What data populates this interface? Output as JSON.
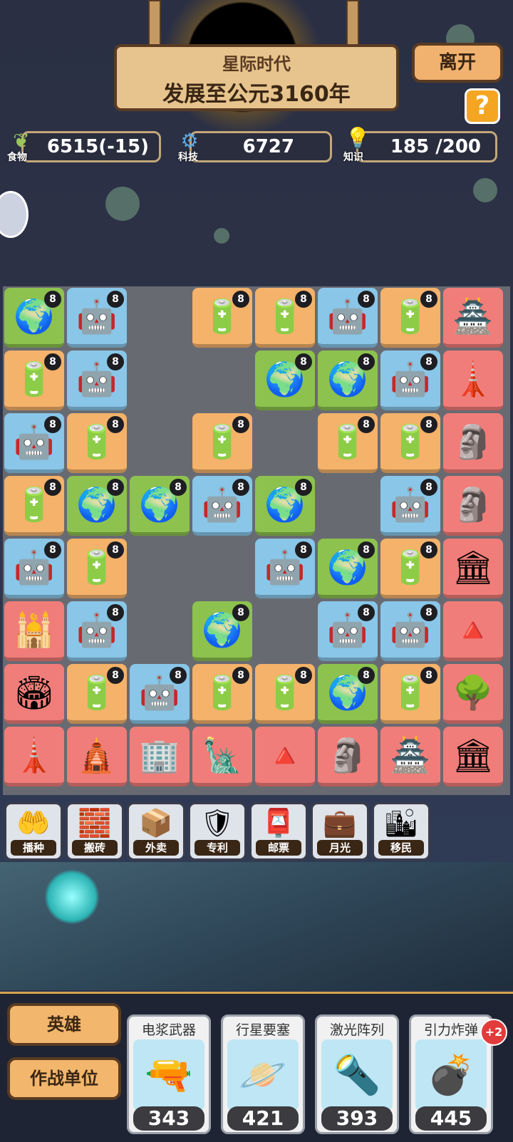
{
  "header": {
    "era": "星际时代",
    "year": "发展至公元3160年",
    "leave_label": "离开",
    "help_label": "?"
  },
  "resources": {
    "food": {
      "label": "食物",
      "value": "6515(-15)",
      "icon": "leaf-icon"
    },
    "tech": {
      "label": "科技",
      "value": "6727",
      "icon": "gear-icon"
    },
    "knowledge": {
      "label": "知识",
      "value": "185 /200",
      "icon": "lightbulb-icon"
    }
  },
  "board": {
    "badge": "8",
    "rows": [
      [
        "planet",
        "robot",
        "empty",
        "battery",
        "battery",
        "robot",
        "battery",
        "great-wall"
      ],
      [
        "battery",
        "robot",
        "empty",
        "empty",
        "planet",
        "planet",
        "robot",
        "eiffel-tower"
      ],
      [
        "robot",
        "battery",
        "empty",
        "battery",
        "empty",
        "battery",
        "battery",
        "stonehenge"
      ],
      [
        "battery",
        "planet",
        "planet",
        "robot",
        "planet",
        "empty",
        "robot",
        "terracotta-army"
      ],
      [
        "robot",
        "battery",
        "empty",
        "empty",
        "robot",
        "planet",
        "battery",
        "zeus-statue"
      ],
      [
        "taj-mahal",
        "robot",
        "empty",
        "planet",
        "empty",
        "robot",
        "robot",
        "pyramid"
      ],
      [
        "colosseum",
        "battery",
        "robot",
        "battery",
        "battery",
        "planet",
        "battery",
        "hanging-gardens"
      ],
      [
        "lighthouse",
        "angkor-wat",
        "leaning-tower",
        "statue-of-liberty",
        "chichen-itza",
        "statue",
        "forbidden-city",
        "temple"
      ]
    ]
  },
  "skills": [
    {
      "label": "播种",
      "icon": "sowing-hand-icon"
    },
    {
      "label": "搬砖",
      "icon": "bricks-icon"
    },
    {
      "label": "外卖",
      "icon": "delivery-box-icon"
    },
    {
      "label": "专利",
      "icon": "patent-badge-icon"
    },
    {
      "label": "邮票",
      "icon": "stamp-icon"
    },
    {
      "label": "月光",
      "icon": "wallet-icon"
    },
    {
      "label": "移民",
      "icon": "city-dome-icon"
    }
  ],
  "tabs": {
    "hero": "英雄",
    "combat_units": "作战单位"
  },
  "units": [
    {
      "name": "电浆武器",
      "count": "343",
      "icon": "plasma-cannon-icon"
    },
    {
      "name": "行星要塞",
      "count": "421",
      "icon": "planet-fortress-icon"
    },
    {
      "name": "激光阵列",
      "count": "393",
      "icon": "laser-array-icon"
    },
    {
      "name": "引力炸弹",
      "count": "445",
      "icon": "gravity-bomb-icon",
      "bonus": "+2"
    }
  ]
}
